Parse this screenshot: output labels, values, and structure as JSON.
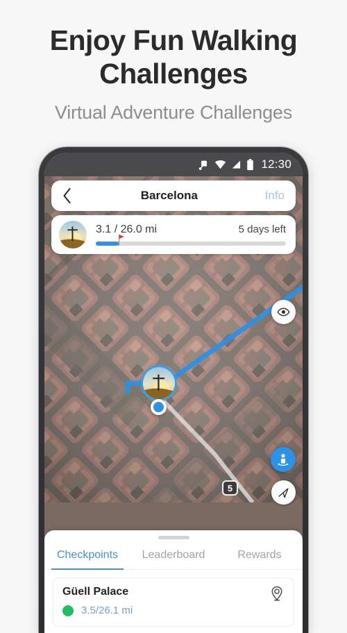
{
  "promo": {
    "title_line1": "Enjoy Fun Walking",
    "title_line2": "Challenges",
    "subtitle": "Virtual Adventure Challenges"
  },
  "status_bar": {
    "time": "12:30",
    "icons": [
      "vibrate-icon",
      "wifi-icon",
      "cellular-signal-icon",
      "battery-icon"
    ]
  },
  "app_bar": {
    "back_label": "‹",
    "title": "Barcelona",
    "info_label": "Info"
  },
  "progress_card": {
    "distance": "3.1 / 26.0 mi",
    "days_left": "5 days left",
    "percent": 12,
    "flag_percent": 12,
    "fill_color": "#3b8fd4",
    "track_color": "#d8d8da",
    "flag_color": "#e8323c"
  },
  "map": {
    "route_color": "#2f8fe0",
    "route_shield_label": "5",
    "buttons": [
      {
        "name": "eye-icon",
        "label": "Show route overview"
      },
      {
        "name": "street-view-icon",
        "label": "Street View"
      },
      {
        "name": "navigation-arrow-icon",
        "label": "My location"
      }
    ]
  },
  "sheet": {
    "tabs": [
      {
        "label": "Checkpoints",
        "active": true
      },
      {
        "label": "Leaderboard",
        "active": false
      },
      {
        "label": "Rewards",
        "active": false
      }
    ],
    "checkpoints": [
      {
        "name": "Güell Palace",
        "distance": "3.5/26.1 mi",
        "status_color": "#20bd63"
      }
    ]
  },
  "colors": {
    "page_background": "#f7f7f8",
    "accent_blue": "#4a90c9",
    "title_text": "#2b2b2b",
    "subtitle_text": "#8c8c91"
  }
}
